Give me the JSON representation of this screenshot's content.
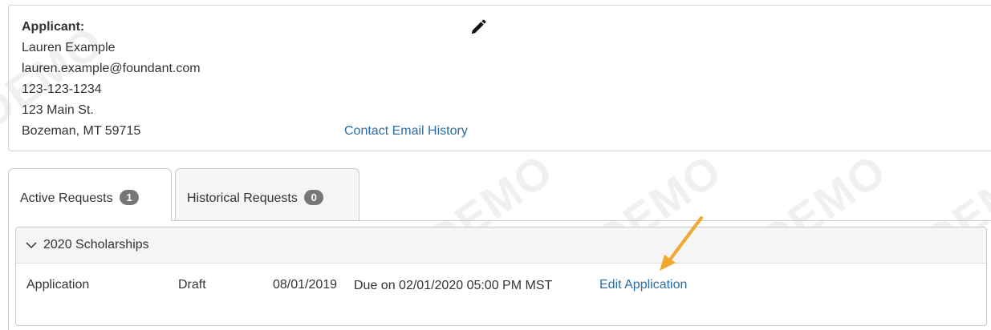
{
  "applicant": {
    "label": "Applicant:",
    "name": "Lauren Example",
    "email": "lauren.example@foundant.com",
    "phone": "123-123-1234",
    "address1": "123 Main St.",
    "address2": "Bozeman, MT 59715",
    "contact_link": "Contact Email History",
    "edit_icon": "pencil-icon"
  },
  "tabs": [
    {
      "label": "Active Requests",
      "count": "1",
      "active": true
    },
    {
      "label": "Historical Requests",
      "count": "0",
      "active": false
    }
  ],
  "panel": {
    "title": "2020 Scholarships",
    "toggle_icon": "chevron-down-icon",
    "rows": [
      {
        "type": "Application",
        "status": "Draft",
        "date": "08/01/2019",
        "due": "Due on 02/01/2020 05:00 PM MST",
        "action": "Edit Application"
      }
    ]
  },
  "watermark": "DEMO",
  "colors": {
    "link": "#2d6ca2",
    "badge": "#777777",
    "arrow": "#f0a830",
    "border": "#c9c9c9"
  }
}
